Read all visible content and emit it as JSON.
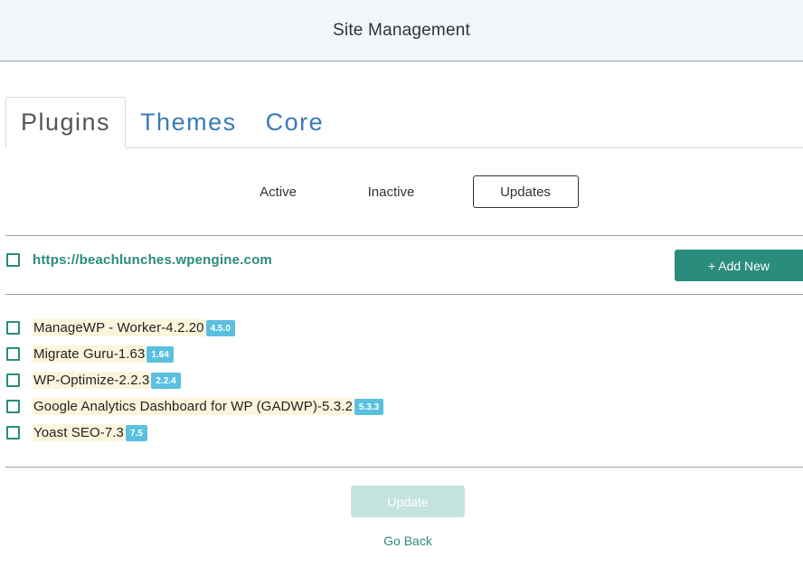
{
  "header": {
    "title": "Site Management"
  },
  "tabs": [
    {
      "label": "Plugins",
      "active": true
    },
    {
      "label": "Themes",
      "active": false
    },
    {
      "label": "Core",
      "active": false
    }
  ],
  "filters": {
    "active": "Active",
    "inactive": "Inactive",
    "updates": "Updates",
    "selected": "Updates"
  },
  "site": {
    "url": "https://beachlunches.wpengine.com",
    "checked": false
  },
  "add_new_label": "+ Add New",
  "plugins": [
    {
      "name": "ManageWP - Worker-4.2.20",
      "update_version": "4.5.0",
      "checked": false
    },
    {
      "name": "Migrate Guru-1.63",
      "update_version": "1.64",
      "checked": false
    },
    {
      "name": "WP-Optimize-2.2.3",
      "update_version": "2.2.4",
      "checked": false
    },
    {
      "name": "Google Analytics Dashboard for WP (GADWP)-5.3.2",
      "update_version": "5.3.3",
      "checked": false
    },
    {
      "name": "Yoast SEO-7.3",
      "update_version": "7.5",
      "checked": false
    }
  ],
  "update_label": "Update",
  "go_back_label": "Go Back",
  "colors": {
    "accent": "#2a8c7c",
    "link_blue": "#3a7ab8",
    "version_badge": "#5bc0de",
    "plugin_highlight": "#fdf4dc",
    "header_bg": "#f2f6fa",
    "update_disabled": "#c5e3de"
  }
}
